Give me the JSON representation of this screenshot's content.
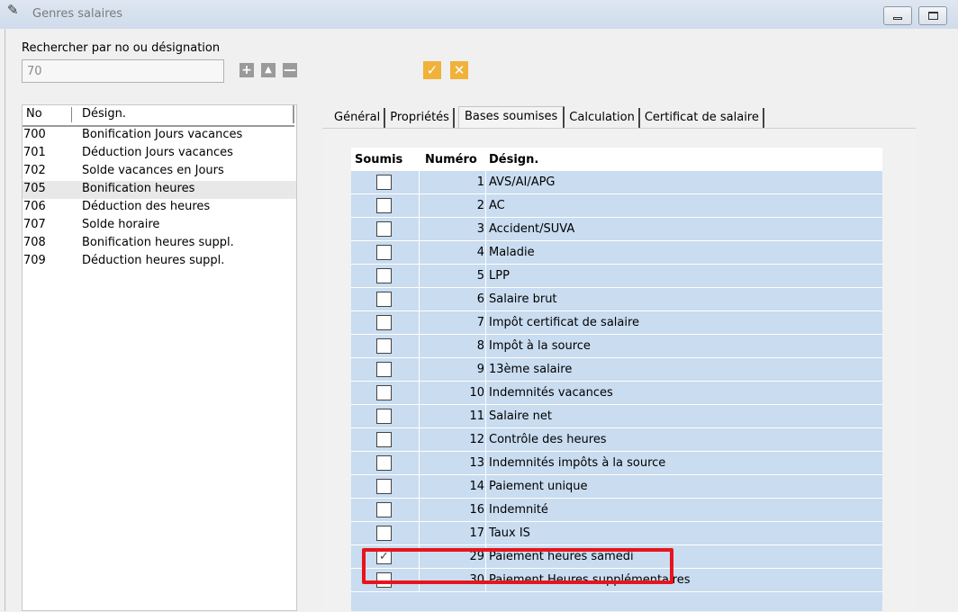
{
  "window": {
    "title": "Genres salaires",
    "icon": "pen-icon"
  },
  "search": {
    "label": "Rechercher par no ou désignation",
    "value": "70",
    "add_glyph": "+",
    "up_glyph": "▲",
    "remove_glyph": "—",
    "confirm_glyph": "✓",
    "cancel_glyph": "✕"
  },
  "list": {
    "headers": {
      "no": "No",
      "design": "Désign."
    },
    "rows": [
      {
        "no": "700",
        "design": "Bonification Jours vacances"
      },
      {
        "no": "701",
        "design": "Déduction Jours vacances"
      },
      {
        "no": "702",
        "design": "Solde vacances en Jours"
      },
      {
        "no": "705",
        "design": "Bonification heures"
      },
      {
        "no": "706",
        "design": "Déduction des heures"
      },
      {
        "no": "707",
        "design": "Solde horaire"
      },
      {
        "no": "708",
        "design": "Bonification heures suppl."
      },
      {
        "no": "709",
        "design": "Déduction heures suppl."
      }
    ],
    "selected_no": "705"
  },
  "tabs": [
    {
      "label": "Général"
    },
    {
      "label": "Propriétés"
    },
    {
      "label": "Bases soumises"
    },
    {
      "label": "Calculation"
    },
    {
      "label": "Certificat de salaire"
    }
  ],
  "active_tab": "Bases soumises",
  "grid": {
    "headers": {
      "soumis": "Soumis",
      "numero": "Numéro",
      "design": "Désign."
    },
    "rows": [
      {
        "checked": false,
        "numero": "1",
        "design": "AVS/AI/APG"
      },
      {
        "checked": false,
        "numero": "2",
        "design": "AC"
      },
      {
        "checked": false,
        "numero": "3",
        "design": "Accident/SUVA"
      },
      {
        "checked": false,
        "numero": "4",
        "design": "Maladie"
      },
      {
        "checked": false,
        "numero": "5",
        "design": "LPP"
      },
      {
        "checked": false,
        "numero": "6",
        "design": "Salaire brut"
      },
      {
        "checked": false,
        "numero": "7",
        "design": "Impôt certificat de salaire"
      },
      {
        "checked": false,
        "numero": "8",
        "design": "Impôt à la source"
      },
      {
        "checked": false,
        "numero": "9",
        "design": "13ème salaire"
      },
      {
        "checked": false,
        "numero": "10",
        "design": "Indemnités vacances"
      },
      {
        "checked": false,
        "numero": "11",
        "design": "Salaire net"
      },
      {
        "checked": false,
        "numero": "12",
        "design": "Contrôle des heures"
      },
      {
        "checked": false,
        "numero": "13",
        "design": "Indemnités impôts à la source"
      },
      {
        "checked": false,
        "numero": "14",
        "design": "Paiement unique"
      },
      {
        "checked": false,
        "numero": "16",
        "design": "Indemnité"
      },
      {
        "checked": false,
        "numero": "17",
        "design": "Taux IS"
      },
      {
        "checked": true,
        "numero": "29",
        "design": "Paiement heures samedi"
      },
      {
        "checked": false,
        "numero": "30",
        "design": "Paiement Heures supplémentaires"
      }
    ]
  },
  "colors": {
    "grid_row_bg": "#c9dcf0",
    "highlight": "#e8141c",
    "confirm": "#f0b23a"
  }
}
